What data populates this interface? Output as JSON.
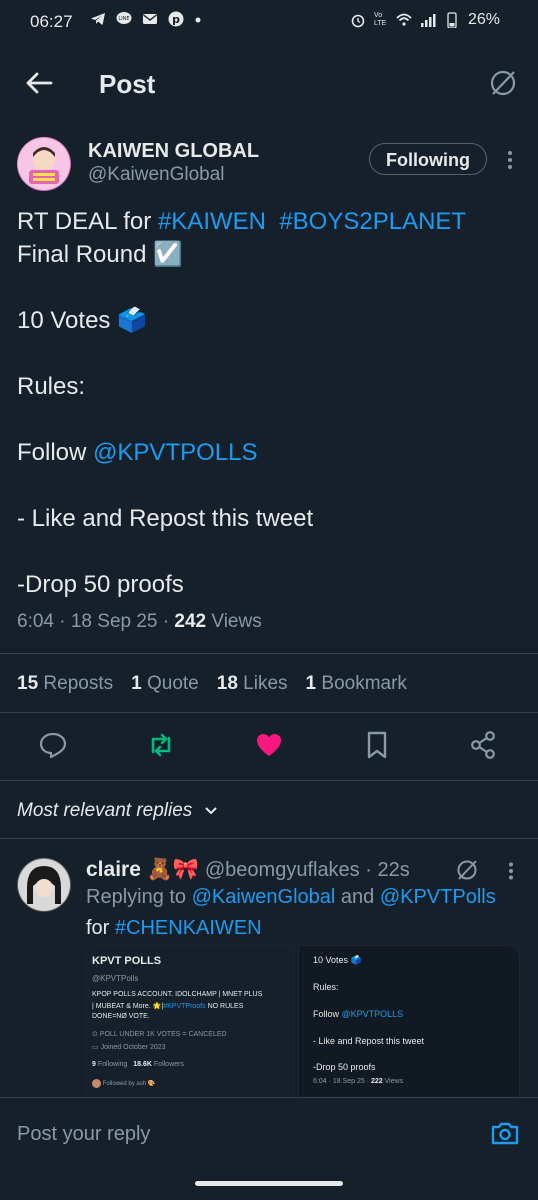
{
  "status_bar": {
    "time": "06:27",
    "battery": "26%",
    "network": "Vo LTE"
  },
  "header": {
    "title": "Post"
  },
  "post": {
    "display_name": "KAIWEN GLOBAL",
    "handle": "@KaiwenGlobal",
    "follow_label": "Following",
    "line1_prefix": "RT DEAL for ",
    "hashtag1": "#KAIWEN",
    "hashtag2": "#BOYS2PLANET",
    "line2": "Final Round ☑️",
    "votes": "10 Votes 🗳️",
    "rules": "Rules:",
    "follow_prefix": "Follow ",
    "mention": "@KPVTPOLLS",
    "like_repost": "- Like and Repost this tweet",
    "drop": "-Drop 50 proofs",
    "timestamp": "6:04 · 18 Sep 25 · ",
    "views_count": "242",
    "views_label": " Views"
  },
  "stats": {
    "reposts_count": "15",
    "reposts_label": "Reposts",
    "quotes_count": "1",
    "quotes_label": "Quote",
    "likes_count": "18",
    "likes_label": "Likes",
    "bookmarks_count": "1",
    "bookmarks_label": "Bookmark"
  },
  "colors": {
    "background": "#15202b",
    "accent": "#1d9bf0",
    "repost_green": "#00ba7c",
    "like_pink": "#f91880"
  },
  "replies_sort": {
    "label": "Most relevant replies"
  },
  "reply": {
    "name": "claire 🧸🎀",
    "handle": "@beomgyuflakes · 22s",
    "replying_prefix": "Replying to ",
    "replying_to1": "@KaiwenGlobal",
    "replying_and": " and ",
    "replying_to2": "@KPVTPolls",
    "text_prefix": "for ",
    "text_hashtag": "#CHENKAIWEN",
    "img1": {
      "name": "KPVT POLLS",
      "handle": "@KPVTPolls",
      "bio1": "KPOP POLLS ACCOUNT. IDOLCHAMP | MNET PLUS",
      "bio2_prefix": "| MUBEAT & More. 🌟|",
      "bio2_link": "#KPVTProofs",
      "bio2_suffix": " NO RULES",
      "bio3": "DONE=NØ VOTE.",
      "poll_note": "POLL UNDER 1K VOTES = CANCELED",
      "joined": "Joined October 2023",
      "following_count": "9",
      "following_label": " Following",
      "followers_count": "18.6K",
      "followers_label": " Followers",
      "followed_by": "Followed by ash 🎨"
    },
    "img2": {
      "votes": "10 Votes 🗳️",
      "rules": "Rules:",
      "follow_prefix": "Follow ",
      "follow_link": "@KPVTPOLLS",
      "like_repost": "- Like and Repost this tweet",
      "drop": "-Drop 50 proofs",
      "meta": "6:04 · 18 Sep 25 · ",
      "views_count": "222",
      "views_label": " Views"
    }
  },
  "composer": {
    "placeholder": "Post your reply"
  }
}
